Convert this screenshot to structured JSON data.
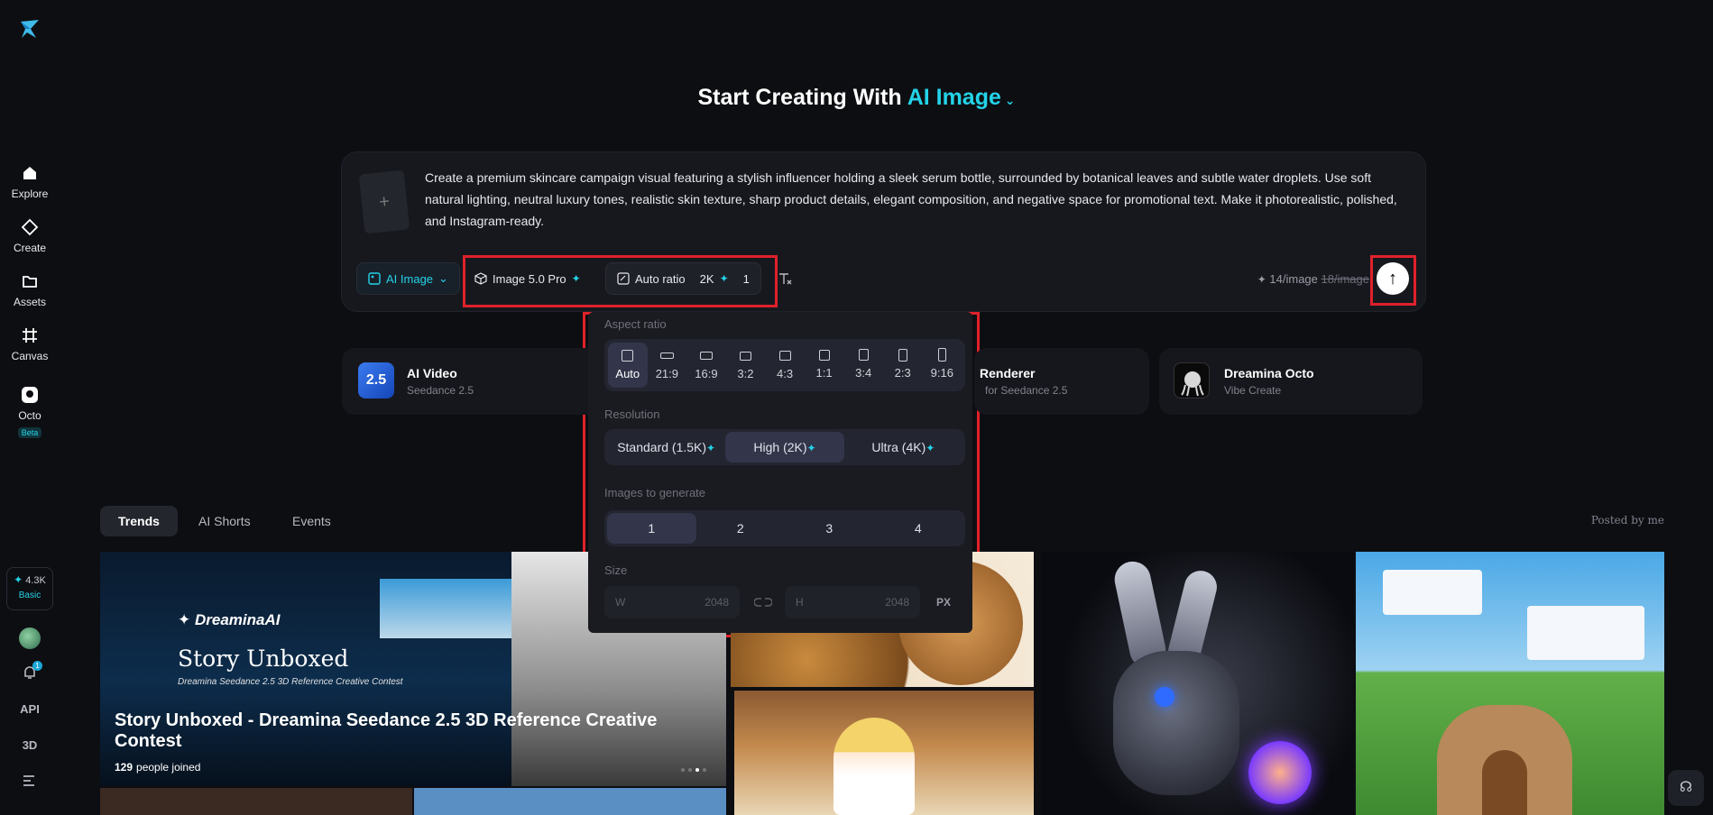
{
  "sidebar": {
    "items": [
      {
        "label": "Explore"
      },
      {
        "label": "Create"
      },
      {
        "label": "Assets"
      },
      {
        "label": "Canvas"
      },
      {
        "label": "Octo",
        "badge": "Beta"
      }
    ],
    "credits": {
      "value": "4.3K",
      "tier": "Basic"
    },
    "notification_count": "1",
    "api_label": "API",
    "three_d_label": "3D"
  },
  "heading": {
    "prefix": "Start Creating With",
    "mode": "AI Image"
  },
  "prompt": {
    "text": "Create a premium skincare campaign visual featuring a stylish influencer holding a sleek serum bottle, surrounded by botanical leaves and subtle water droplets. Use soft natural lighting, neutral luxury tones, realistic skin texture, sharp product details, elegant composition, and negative space for promotional text. Make it photorealistic, polished, and Instagram-ready.",
    "mode_pill": "AI Image",
    "model_pill": "Image 5.0 Pro",
    "ratio_pill": "Auto ratio",
    "resolution_pill": "2K",
    "count_pill": "1",
    "cost_current": "14/image",
    "cost_old": "18/image"
  },
  "features": [
    {
      "title": "AI Video",
      "subtitle": "Seedance 2.5",
      "icon_text": "2.5"
    },
    {
      "title": "Renderer",
      "subtitle": "for Seedance 2.5"
    },
    {
      "title": "Dreamina Octo",
      "subtitle": "Vibe Create"
    }
  ],
  "tabs": [
    "Trends",
    "AI Shorts",
    "Events"
  ],
  "posted_by": "Posted by me",
  "contest": {
    "brand": "DreaminaAI",
    "banner_title": "Story Unboxed",
    "banner_subtitle": "Dreamina Seedance 2.5 3D Reference Creative Contest",
    "title": "Story Unboxed - Dreamina Seedance 2.5 3D Reference Creative Contest",
    "joined_count": "129",
    "joined_label": "people joined"
  },
  "popup": {
    "aspect_label": "Aspect ratio",
    "ratios": [
      "Auto",
      "21:9",
      "16:9",
      "3:2",
      "4:3",
      "1:1",
      "3:4",
      "2:3",
      "9:16"
    ],
    "resolution_label": "Resolution",
    "resolutions": [
      "Standard (1.5K)",
      "High (2K)",
      "Ultra (4K)"
    ],
    "images_label": "Images to generate",
    "counts": [
      "1",
      "2",
      "3",
      "4"
    ],
    "size_label": "Size",
    "w_label": "W",
    "w_value": "2048",
    "h_label": "H",
    "h_value": "2048",
    "unit": "PX"
  }
}
